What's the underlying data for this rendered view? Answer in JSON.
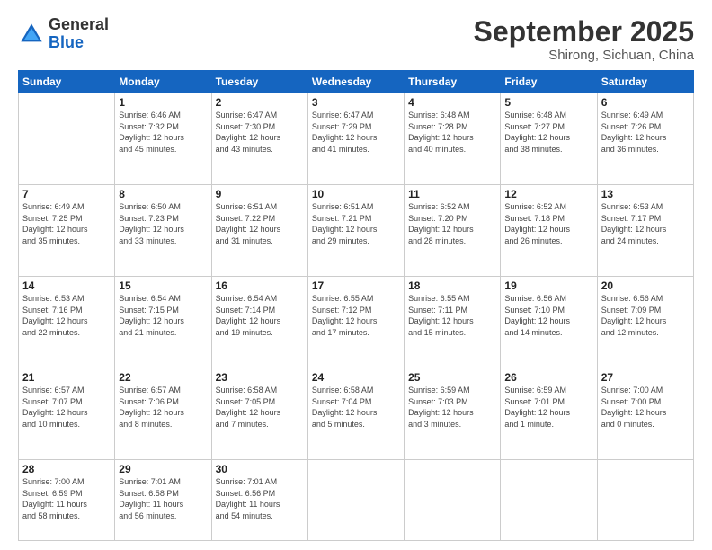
{
  "logo": {
    "general": "General",
    "blue": "Blue"
  },
  "header": {
    "month": "September 2025",
    "location": "Shirong, Sichuan, China"
  },
  "weekdays": [
    "Sunday",
    "Monday",
    "Tuesday",
    "Wednesday",
    "Thursday",
    "Friday",
    "Saturday"
  ],
  "weeks": [
    [
      {
        "day": "",
        "info": ""
      },
      {
        "day": "1",
        "info": "Sunrise: 6:46 AM\nSunset: 7:32 PM\nDaylight: 12 hours\nand 45 minutes."
      },
      {
        "day": "2",
        "info": "Sunrise: 6:47 AM\nSunset: 7:30 PM\nDaylight: 12 hours\nand 43 minutes."
      },
      {
        "day": "3",
        "info": "Sunrise: 6:47 AM\nSunset: 7:29 PM\nDaylight: 12 hours\nand 41 minutes."
      },
      {
        "day": "4",
        "info": "Sunrise: 6:48 AM\nSunset: 7:28 PM\nDaylight: 12 hours\nand 40 minutes."
      },
      {
        "day": "5",
        "info": "Sunrise: 6:48 AM\nSunset: 7:27 PM\nDaylight: 12 hours\nand 38 minutes."
      },
      {
        "day": "6",
        "info": "Sunrise: 6:49 AM\nSunset: 7:26 PM\nDaylight: 12 hours\nand 36 minutes."
      }
    ],
    [
      {
        "day": "7",
        "info": "Sunrise: 6:49 AM\nSunset: 7:25 PM\nDaylight: 12 hours\nand 35 minutes."
      },
      {
        "day": "8",
        "info": "Sunrise: 6:50 AM\nSunset: 7:23 PM\nDaylight: 12 hours\nand 33 minutes."
      },
      {
        "day": "9",
        "info": "Sunrise: 6:51 AM\nSunset: 7:22 PM\nDaylight: 12 hours\nand 31 minutes."
      },
      {
        "day": "10",
        "info": "Sunrise: 6:51 AM\nSunset: 7:21 PM\nDaylight: 12 hours\nand 29 minutes."
      },
      {
        "day": "11",
        "info": "Sunrise: 6:52 AM\nSunset: 7:20 PM\nDaylight: 12 hours\nand 28 minutes."
      },
      {
        "day": "12",
        "info": "Sunrise: 6:52 AM\nSunset: 7:18 PM\nDaylight: 12 hours\nand 26 minutes."
      },
      {
        "day": "13",
        "info": "Sunrise: 6:53 AM\nSunset: 7:17 PM\nDaylight: 12 hours\nand 24 minutes."
      }
    ],
    [
      {
        "day": "14",
        "info": "Sunrise: 6:53 AM\nSunset: 7:16 PM\nDaylight: 12 hours\nand 22 minutes."
      },
      {
        "day": "15",
        "info": "Sunrise: 6:54 AM\nSunset: 7:15 PM\nDaylight: 12 hours\nand 21 minutes."
      },
      {
        "day": "16",
        "info": "Sunrise: 6:54 AM\nSunset: 7:14 PM\nDaylight: 12 hours\nand 19 minutes."
      },
      {
        "day": "17",
        "info": "Sunrise: 6:55 AM\nSunset: 7:12 PM\nDaylight: 12 hours\nand 17 minutes."
      },
      {
        "day": "18",
        "info": "Sunrise: 6:55 AM\nSunset: 7:11 PM\nDaylight: 12 hours\nand 15 minutes."
      },
      {
        "day": "19",
        "info": "Sunrise: 6:56 AM\nSunset: 7:10 PM\nDaylight: 12 hours\nand 14 minutes."
      },
      {
        "day": "20",
        "info": "Sunrise: 6:56 AM\nSunset: 7:09 PM\nDaylight: 12 hours\nand 12 minutes."
      }
    ],
    [
      {
        "day": "21",
        "info": "Sunrise: 6:57 AM\nSunset: 7:07 PM\nDaylight: 12 hours\nand 10 minutes."
      },
      {
        "day": "22",
        "info": "Sunrise: 6:57 AM\nSunset: 7:06 PM\nDaylight: 12 hours\nand 8 minutes."
      },
      {
        "day": "23",
        "info": "Sunrise: 6:58 AM\nSunset: 7:05 PM\nDaylight: 12 hours\nand 7 minutes."
      },
      {
        "day": "24",
        "info": "Sunrise: 6:58 AM\nSunset: 7:04 PM\nDaylight: 12 hours\nand 5 minutes."
      },
      {
        "day": "25",
        "info": "Sunrise: 6:59 AM\nSunset: 7:03 PM\nDaylight: 12 hours\nand 3 minutes."
      },
      {
        "day": "26",
        "info": "Sunrise: 6:59 AM\nSunset: 7:01 PM\nDaylight: 12 hours\nand 1 minute."
      },
      {
        "day": "27",
        "info": "Sunrise: 7:00 AM\nSunset: 7:00 PM\nDaylight: 12 hours\nand 0 minutes."
      }
    ],
    [
      {
        "day": "28",
        "info": "Sunrise: 7:00 AM\nSunset: 6:59 PM\nDaylight: 11 hours\nand 58 minutes."
      },
      {
        "day": "29",
        "info": "Sunrise: 7:01 AM\nSunset: 6:58 PM\nDaylight: 11 hours\nand 56 minutes."
      },
      {
        "day": "30",
        "info": "Sunrise: 7:01 AM\nSunset: 6:56 PM\nDaylight: 11 hours\nand 54 minutes."
      },
      {
        "day": "",
        "info": ""
      },
      {
        "day": "",
        "info": ""
      },
      {
        "day": "",
        "info": ""
      },
      {
        "day": "",
        "info": ""
      }
    ]
  ]
}
